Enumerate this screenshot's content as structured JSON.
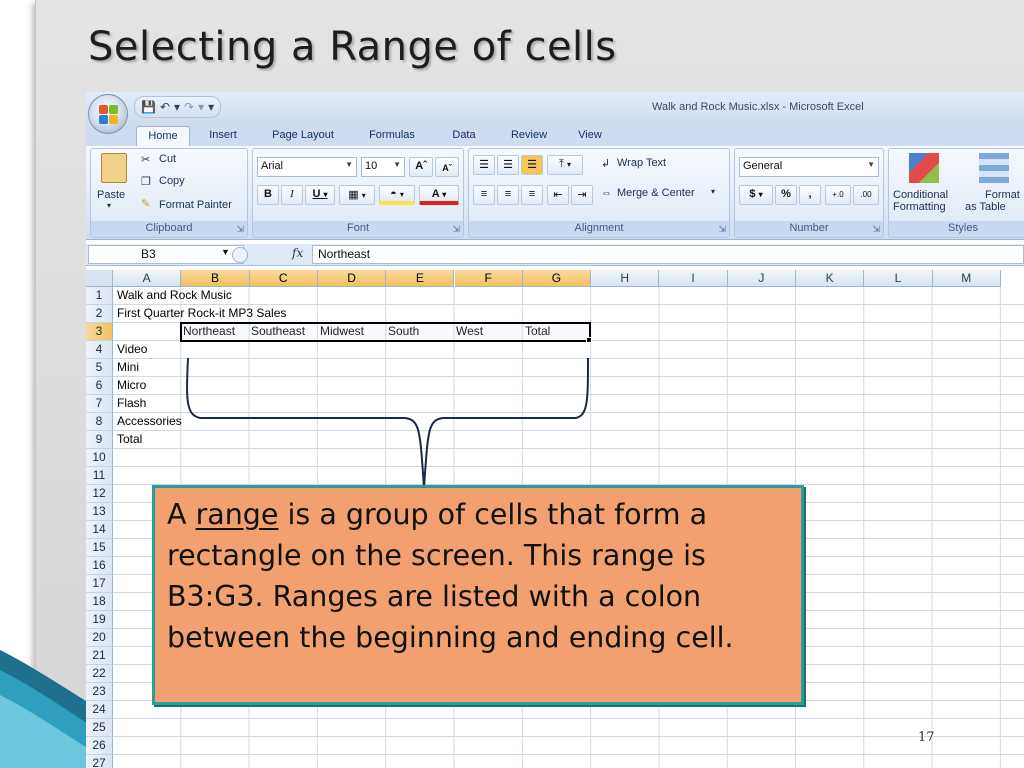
{
  "slide": {
    "title": "Selecting a Range of cells",
    "page_number": "17"
  },
  "excel": {
    "window_title": "Walk and Rock Music.xlsx - Microsoft Excel",
    "tabs": [
      "Home",
      "Insert",
      "Page Layout",
      "Formulas",
      "Data",
      "Review",
      "View"
    ],
    "active_tab": "Home",
    "clipboard": {
      "paste": "Paste",
      "cut": "Cut",
      "copy": "Copy",
      "format_painter": "Format Painter",
      "label": "Clipboard"
    },
    "font": {
      "name": "Arial",
      "size": "10",
      "bold": "B",
      "italic": "I",
      "underline": "U",
      "label": "Font"
    },
    "alignment": {
      "wrap_text": "Wrap Text",
      "merge_center": "Merge & Center",
      "label": "Alignment"
    },
    "number": {
      "format": "General",
      "currency": "$",
      "percent": "%",
      "comma": ",",
      "inc_decimal": "+.0",
      "dec_decimal": ".00",
      "label": "Number"
    },
    "styles": {
      "conditional_formatting_1": "Conditional",
      "conditional_formatting_2": "Formatting",
      "format_table_1": "Format",
      "format_table_2": "as Table",
      "label": "Styles"
    },
    "name_box": "B3",
    "fx": "fx",
    "formula": "Northeast",
    "columns": [
      "A",
      "B",
      "C",
      "D",
      "E",
      "F",
      "G",
      "H",
      "I",
      "J",
      "K",
      "L",
      "M"
    ],
    "rows": [
      "1",
      "2",
      "3",
      "4",
      "5",
      "6",
      "7",
      "8",
      "9",
      "10",
      "11",
      "12",
      "13",
      "14",
      "15",
      "16",
      "17",
      "18",
      "19",
      "20",
      "21",
      "22",
      "23",
      "24",
      "25",
      "26",
      "27"
    ],
    "cells": {
      "A1": "Walk and Rock Music",
      "A2": "First Quarter Rock-it MP3 Sales",
      "B3": "Northeast",
      "C3": "Southeast",
      "D3": "Midwest",
      "E3": "South",
      "F3": "West",
      "G3": "Total",
      "A4": "Video",
      "A5": "Mini",
      "A6": "Micro",
      "A7": "Flash",
      "A8": "Accessories",
      "A9": "Total"
    }
  },
  "callout": {
    "prefix": "A ",
    "keyword": "range",
    "body": " is a group of cells that form a rectangle on the screen.  This range is B3:G3.  Ranges are listed with a colon between the beginning and ending cell."
  },
  "colors": {
    "callout_fill": "#f2a070",
    "callout_border": "#2a9d9f",
    "ribbon": "#dde8f6",
    "selected_header": "#f1c15f"
  }
}
